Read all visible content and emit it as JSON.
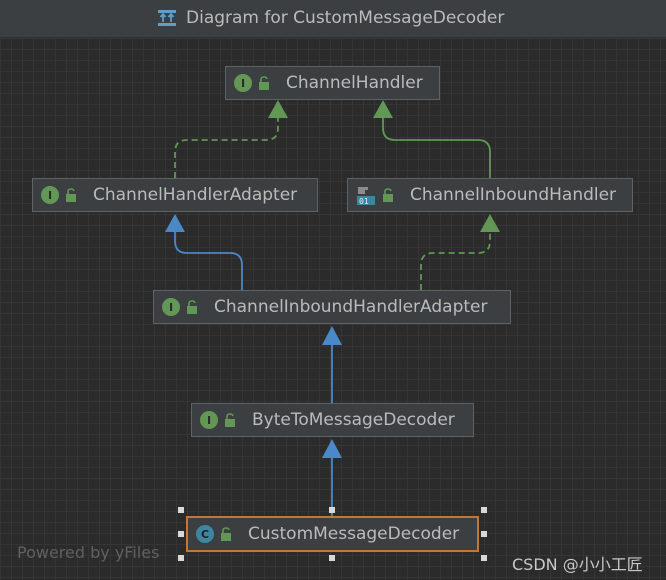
{
  "window": {
    "title": "Diagram for CustomMessageDecoder"
  },
  "nodes": {
    "channel_handler": "ChannelHandler",
    "channel_handler_adapter": "ChannelHandlerAdapter",
    "channel_inbound_handler": "ChannelInboundHandler",
    "channel_inbound_handler_adapter": "ChannelInboundHandlerAdapter",
    "byte_to_message_decoder": "ByteToMessageDecoder",
    "custom_message_decoder": "CustomMessageDecoder"
  },
  "badges": {
    "interface": "I",
    "class": "C",
    "deprecated_icon_text": "01"
  },
  "footer": {
    "powered_by": "Powered by yFiles",
    "watermark": "CSDN @小小工匠"
  },
  "colors": {
    "background": "#2b2b2b",
    "node_fill": "#3c3f41",
    "interface_green": "#629755",
    "extends_blue": "#4a88c7",
    "implements_green": "#629755",
    "selection_orange": "#c57633"
  }
}
